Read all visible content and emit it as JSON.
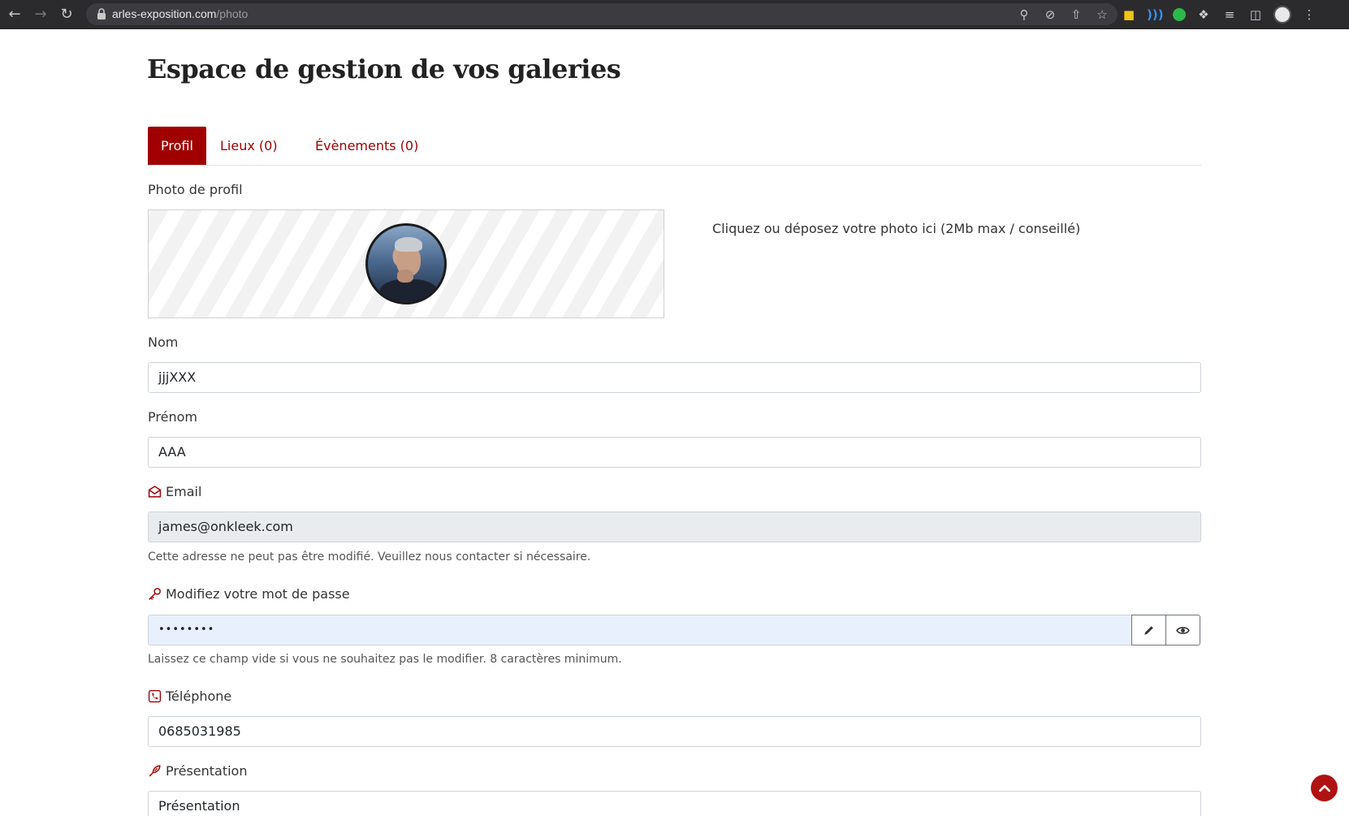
{
  "browser": {
    "url_host": "arles-exposition.com",
    "url_path": "/photo"
  },
  "page": {
    "title": "Espace de gestion de vos galeries"
  },
  "tabs": [
    {
      "label": "Profil",
      "active": true
    },
    {
      "label": "Lieux (0)",
      "active": false
    },
    {
      "label": "Évènements (0)",
      "active": false
    }
  ],
  "profile_photo": {
    "label": "Photo de profil",
    "drop_hint": "Cliquez ou déposez votre photo ici (2Mb max / conseillé)"
  },
  "form": {
    "nom": {
      "label": "Nom",
      "value": "jjjXXX"
    },
    "prenom": {
      "label": "Prénom",
      "value": "AAA"
    },
    "email": {
      "label": "Email",
      "value": "james@onkleek.com",
      "help": "Cette adresse ne peut pas être modifié. Veuillez nous contacter si nécessaire."
    },
    "password": {
      "label": "Modifiez votre mot de passe",
      "value": "••••••••",
      "help": "Laissez ce champ vide si vous ne souhaitez pas le modifier. 8 caractères minimum."
    },
    "telephone": {
      "label": "Téléphone",
      "value": "0685031985"
    },
    "presentation": {
      "label": "Présentation",
      "value": "Présentation"
    }
  },
  "colors": {
    "accent": "#a00000",
    "autofill": "#e8f0fe",
    "disabled": "#e9ecef"
  }
}
